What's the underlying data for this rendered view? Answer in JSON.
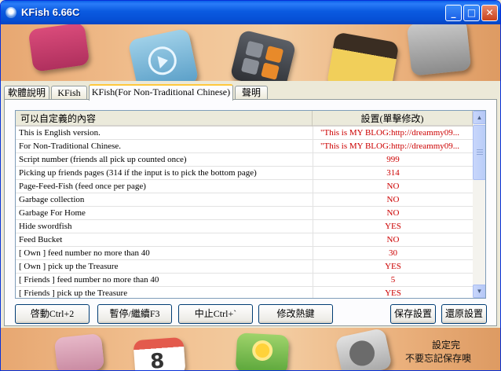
{
  "window": {
    "title": "KFish 6.66C",
    "controls": {
      "minimize": "_",
      "maximize": "□",
      "close": "✕"
    }
  },
  "tabs": [
    {
      "label": "軟體說明",
      "active": false
    },
    {
      "label": "KFish",
      "active": false
    },
    {
      "label": "KFish(For Non-Traditional Chinese)",
      "active": true
    },
    {
      "label": "聲明",
      "active": false
    }
  ],
  "grid": {
    "headers": {
      "name": "可以自定義的內容",
      "value": "設置(單擊修改)"
    },
    "rows": [
      {
        "name": "This is English version.",
        "value": "\"This is MY BLOG:http://dreammy09..."
      },
      {
        "name": "For Non-Traditional Chinese.",
        "value": "\"This is MY BLOG:http://dreammy09..."
      },
      {
        "name": "Script number (friends all pick up counted once)",
        "value": "999"
      },
      {
        "name": "Picking up friends pages (314 if the input is to pick the bottom page)",
        "value": "314"
      },
      {
        "name": "Page-Feed-Fish (feed once per page)",
        "value": "NO"
      },
      {
        "name": "Garbage collection",
        "value": "NO"
      },
      {
        "name": "Garbage For Home",
        "value": "NO"
      },
      {
        "name": "Hide swordfish",
        "value": "YES"
      },
      {
        "name": "Feed Bucket",
        "value": "NO"
      },
      {
        "name": "[ Own ] feed number no more than 40",
        "value": "30"
      },
      {
        "name": "[ Own ] pick up the Treasure",
        "value": "YES"
      },
      {
        "name": "[ Friends ] feed number no more than 40",
        "value": "5"
      },
      {
        "name": "[ Friends ] pick up the Treasure",
        "value": "YES"
      }
    ]
  },
  "buttons": {
    "start": "啓動Ctrl+2",
    "pause": "暫停/繼續F3",
    "stop": "中止Ctrl+`",
    "hotkeys": "修改熱鍵",
    "save": "保存設置",
    "restore": "還原設置"
  },
  "banner_bottom": {
    "tile_number": "8",
    "note_line1": "設定完",
    "note_line2": "不要忘記保存噢"
  }
}
